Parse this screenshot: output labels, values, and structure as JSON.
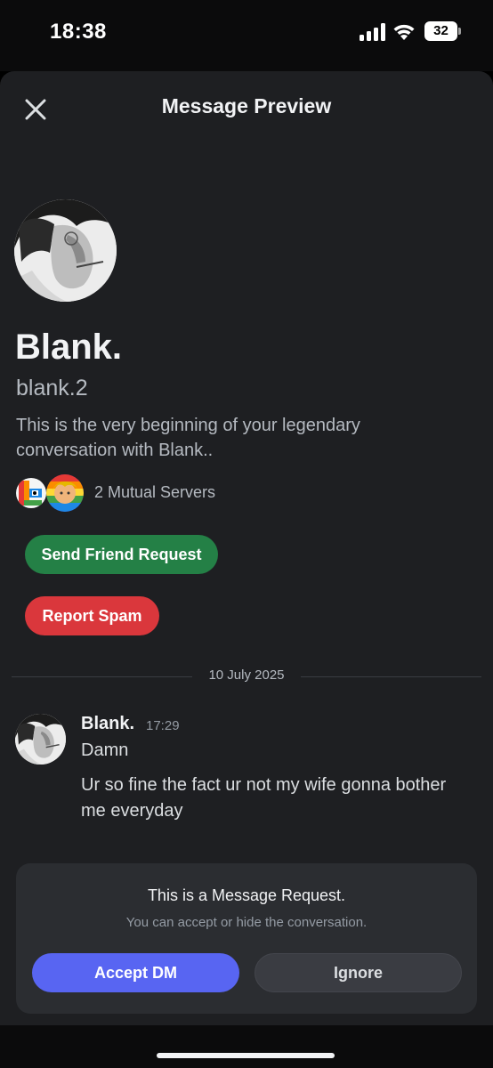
{
  "status_bar": {
    "time": "18:38",
    "battery_level": "32",
    "icons": [
      "signal-icon",
      "wifi-icon",
      "battery-icon"
    ]
  },
  "header": {
    "title": "Message Preview",
    "close_icon": "close-icon"
  },
  "profile": {
    "display_name": "Blank.",
    "username": "blank.2",
    "intro": "This is the very beginning of your legendary conversation with Blank..",
    "mutual_servers_label": "2 Mutual Servers"
  },
  "actions": {
    "send_friend_request": "Send Friend Request",
    "report_spam": "Report Spam"
  },
  "conversation": {
    "date_divider": "10 July 2025",
    "messages": [
      {
        "author": "Blank.",
        "time": "17:29",
        "lines": [
          "Damn",
          "Ur so fine the fact ur not my wife gonna bother me everyday"
        ]
      }
    ]
  },
  "request_card": {
    "title": "This is a Message Request.",
    "subtitle": "You can accept or hide the conversation.",
    "accept_label": "Accept DM",
    "ignore_label": "Ignore"
  },
  "colors": {
    "background": "#1e1f22",
    "friend_button": "#248046",
    "spam_button": "#da373c",
    "accept_button": "#5865f2",
    "ignore_button": "#3a3c42"
  }
}
